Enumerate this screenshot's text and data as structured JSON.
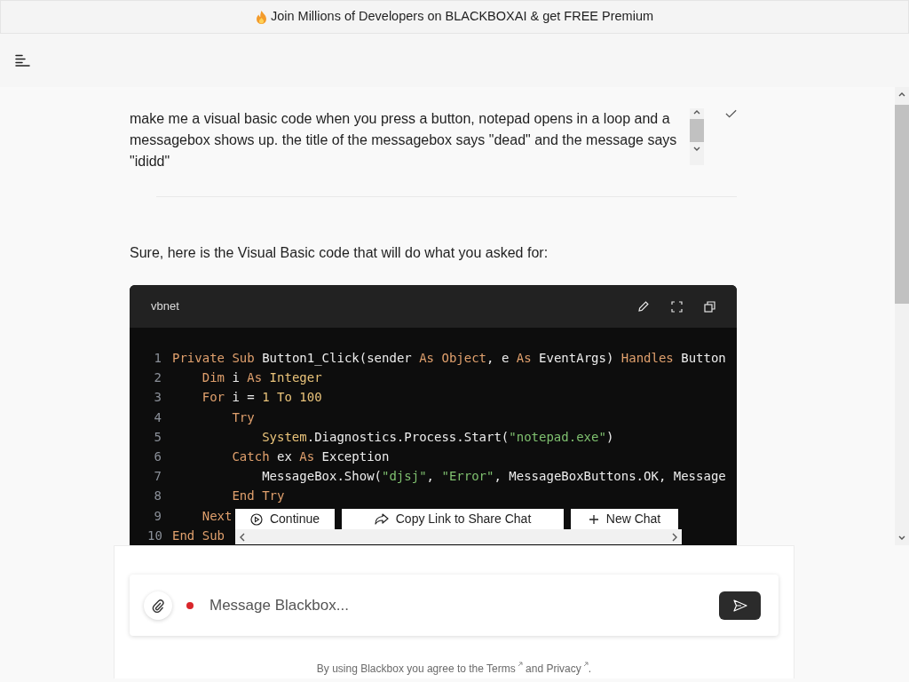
{
  "banner": {
    "text": "Join Millions of Developers on BLACKBOXAI & get FREE Premium"
  },
  "prompt": {
    "text": "make me a visual basic code when you press a button, notepad opens in a loop and a messagebox shows up. the title of the messagebox says \"dead\" and the message says \"ididd\""
  },
  "answer": {
    "intro": "Sure, here is the Visual Basic code that will do what you asked for:"
  },
  "code_block": {
    "language": "vbnet",
    "lines": [
      {
        "number": "1",
        "tokens": [
          {
            "kind": "kw",
            "text": "Private "
          },
          {
            "kind": "kw",
            "text": "Sub"
          },
          {
            "kind": "plain",
            "text": " Button1_Click(sender "
          },
          {
            "kind": "kw",
            "text": "As "
          },
          {
            "kind": "kw",
            "text": "Object"
          },
          {
            "kind": "plain",
            "text": ", e "
          },
          {
            "kind": "kw",
            "text": "As"
          },
          {
            "kind": "plain",
            "text": " EventArgs) "
          },
          {
            "kind": "kw",
            "text": "Handles"
          },
          {
            "kind": "plain",
            "text": " Button"
          }
        ]
      },
      {
        "number": "2",
        "tokens": [
          {
            "kind": "kw",
            "text": "    Dim"
          },
          {
            "kind": "plain",
            "text": " i "
          },
          {
            "kind": "kw",
            "text": "As "
          },
          {
            "kind": "num",
            "text": "Integer"
          }
        ]
      },
      {
        "number": "3",
        "tokens": [
          {
            "kind": "kw",
            "text": "    For"
          },
          {
            "kind": "plain",
            "text": " i = "
          },
          {
            "kind": "num",
            "text": "1 "
          },
          {
            "kind": "num",
            "text": "To "
          },
          {
            "kind": "num",
            "text": "100"
          }
        ]
      },
      {
        "number": "4",
        "tokens": [
          {
            "kind": "kw",
            "text": "        Try"
          }
        ]
      },
      {
        "number": "5",
        "tokens": [
          {
            "kind": "num",
            "text": "            System"
          },
          {
            "kind": "plain",
            "text": ".Diagnostics.Process.Start("
          },
          {
            "kind": "str",
            "text": "\"notepad.exe\""
          },
          {
            "kind": "plain",
            "text": ")"
          }
        ]
      },
      {
        "number": "6",
        "tokens": [
          {
            "kind": "kw",
            "text": "        Catch"
          },
          {
            "kind": "plain",
            "text": " ex "
          },
          {
            "kind": "kw",
            "text": "As"
          },
          {
            "kind": "plain",
            "text": " Exception"
          }
        ]
      },
      {
        "number": "7",
        "tokens": [
          {
            "kind": "plain",
            "text": "            MessageBox.Show("
          },
          {
            "kind": "str",
            "text": "\"djsj\""
          },
          {
            "kind": "plain",
            "text": ", "
          },
          {
            "kind": "str",
            "text": "\"Error\""
          },
          {
            "kind": "plain",
            "text": ", MessageBoxButtons.OK, Message"
          }
        ]
      },
      {
        "number": "8",
        "tokens": [
          {
            "kind": "kw",
            "text": "        End Try"
          }
        ]
      },
      {
        "number": "9",
        "tokens": [
          {
            "kind": "kw",
            "text": "    Next"
          }
        ]
      },
      {
        "number": "10",
        "tokens": [
          {
            "kind": "kw",
            "text": "End Sub"
          }
        ]
      }
    ]
  },
  "action_bar": {
    "buttons": [
      {
        "kind": "continue",
        "label": "Continue"
      },
      {
        "kind": "share",
        "label": "Copy Link to Share Chat"
      },
      {
        "kind": "new",
        "label": "New Chat"
      }
    ]
  },
  "composer": {
    "placeholder": "Message Blackbox..."
  },
  "footer": {
    "before": "By using Blackbox you agree to the",
    "terms": "Terms",
    "middle": "and",
    "privacy": "Privacy",
    "after": "."
  }
}
